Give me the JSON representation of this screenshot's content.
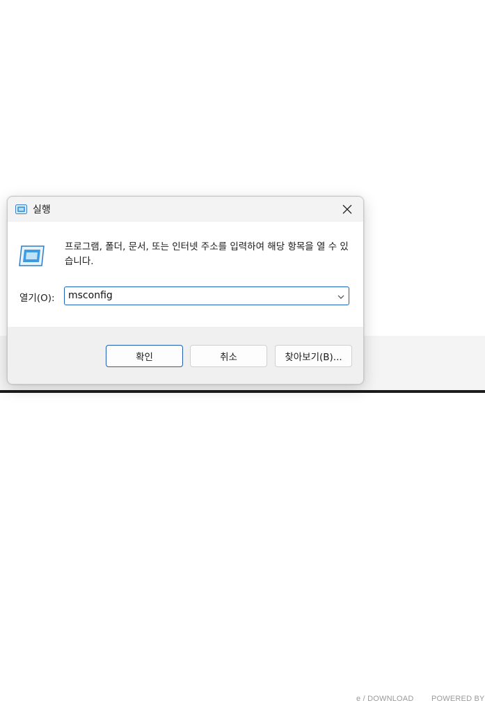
{
  "background": {
    "footer_left": "e / DOWNLOAD",
    "footer_right": "POWERED BY T"
  },
  "dialog": {
    "title": "실행",
    "description": "프로그램, 폴더, 문서, 또는 인터넷 주소를 입력하여 해당 항목을 열 수 있습니다.",
    "open_label": "열기(O):",
    "open_value": "msconfig",
    "buttons": {
      "ok": "확인",
      "cancel": "취소",
      "browse": "찾아보기(B)..."
    }
  },
  "colors": {
    "accent": "#1a63b8",
    "dialog_bg": "#f0f0f0",
    "content_bg": "#ffffff"
  },
  "icons": [
    "run-icon",
    "close-icon",
    "run-large-icon",
    "chevron-down-icon"
  ]
}
